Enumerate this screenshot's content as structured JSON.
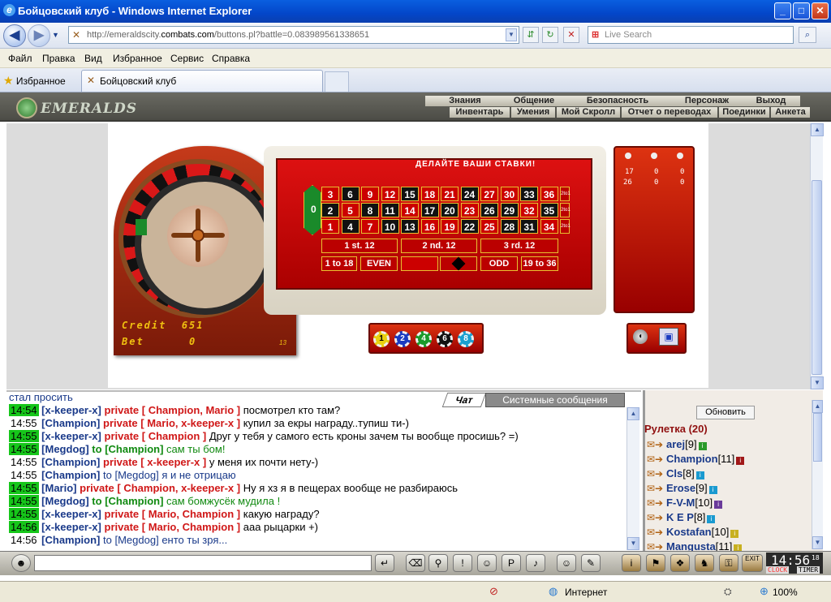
{
  "window": {
    "title": "Бойцовский клуб - Windows Internet Explorer",
    "min": "_",
    "max": "□",
    "close": "✕"
  },
  "nav": {
    "url_prefix": "http://emeraldscity.",
    "url_domain": "combats.com",
    "url_suffix": "/buttons.pl?battle=0.083989561338651",
    "search_placeholder": "Live Search"
  },
  "menu": [
    "Файл",
    "Правка",
    "Вид",
    "Избранное",
    "Сервис",
    "Справка"
  ],
  "favorites_label": "Избранное",
  "tab_title": "Бойцовский клуб",
  "game_header": {
    "logo": "EMERALDS",
    "top_links": [
      "Знания",
      "Общение",
      "Безопасность",
      "Персонаж",
      "Выход"
    ],
    "bottom_links": [
      "Инвентарь",
      "Умения",
      "Мой Скролл",
      "Отчет о переводах",
      "Поединки",
      "Анкета"
    ]
  },
  "roulette": {
    "bet_title": "ДЕЛАЙТЕ ВАШИ СТАВКИ!",
    "credit_label": "Credit",
    "credit_value": "651",
    "bet_label": "Bet",
    "bet_value": "0",
    "small_num": "13",
    "row1": [
      "3",
      "6",
      "9",
      "12",
      "15",
      "18",
      "21",
      "24",
      "27",
      "30",
      "33",
      "36"
    ],
    "row2": [
      "2",
      "5",
      "8",
      "11",
      "14",
      "17",
      "20",
      "23",
      "26",
      "29",
      "32",
      "35"
    ],
    "row3": [
      "1",
      "4",
      "7",
      "10",
      "13",
      "16",
      "19",
      "22",
      "25",
      "28",
      "31",
      "34"
    ],
    "col_label": "2to1",
    "zero": "0",
    "dozens": [
      "1 st. 12",
      "2 nd. 12",
      "3 rd. 12"
    ],
    "outside": [
      "1 to 18",
      "EVEN",
      "ODD",
      "19 to 36"
    ],
    "chips": [
      "1",
      "2",
      "4",
      "6",
      "8"
    ],
    "side_row1": [
      "17",
      "0",
      "0"
    ],
    "side_row2": [
      "26",
      "0",
      "0"
    ]
  },
  "chat": {
    "first_line": "стал просить",
    "tab_chat": "Чат",
    "tab_system": "Системные сообщения",
    "lines": [
      {
        "time": "14:54",
        "green": true,
        "nick": "[x-keeper-x]",
        "kind": "private",
        "target": "[ Champion, Mario ]",
        "text": "посмотрел кто там?"
      },
      {
        "time": "14:55",
        "green": false,
        "nick": "[Champion]",
        "kind": "private",
        "target": "[ Mario, x-keeper-x ]",
        "text": "купил за екры награду..тупиш ти-)"
      },
      {
        "time": "14:55",
        "green": true,
        "nick": "[x-keeper-x]",
        "kind": "private",
        "target": "[ Champion ]",
        "text": "Друг у тебя у самого есть кроны зачем ты вообще просишь? =)"
      },
      {
        "time": "14:55",
        "green": true,
        "nick": "[Megdog]",
        "kind": "to",
        "target": "[Champion]",
        "text": "сам ты бом!"
      },
      {
        "time": "14:55",
        "green": false,
        "nick": "[Champion]",
        "kind": "private",
        "target": "[ x-keeper-x ]",
        "text": "у меня их почти нету-)"
      },
      {
        "time": "14:55",
        "green": false,
        "nick": "[Champion]",
        "kind": "to2",
        "target": "[Megdog]",
        "text": "я и не отрицаю"
      },
      {
        "time": "14:55",
        "green": true,
        "nick": "[Mario]",
        "kind": "private",
        "target": "[ Champion, x-keeper-x ]",
        "text": "Ну я хз я в пещерах вообще не разбираюсь"
      },
      {
        "time": "14:55",
        "green": true,
        "nick": "[Megdog]",
        "kind": "to",
        "target": "[Champion]",
        "text": "сам бомжусёк мудила !"
      },
      {
        "time": "14:55",
        "green": true,
        "nick": "[x-keeper-x]",
        "kind": "private",
        "target": "[ Mario, Champion ]",
        "text": "какую награду?"
      },
      {
        "time": "14:56",
        "green": true,
        "nick": "[x-keeper-x]",
        "kind": "private",
        "target": "[ Mario, Champion ]",
        "text": "ааа рыцарки +)"
      },
      {
        "time": "14:56",
        "green": false,
        "nick": "[Champion]",
        "kind": "to2",
        "target": "[Megdog]",
        "text": "енто ты зря..."
      }
    ],
    "private_word": "private",
    "to_word": "to"
  },
  "users": {
    "refresh": "Обновить",
    "room": "Рулетка (20)",
    "list": [
      {
        "name": "arej",
        "lvl": "[9]",
        "badge": "G"
      },
      {
        "name": "Champion",
        "lvl": "[11]",
        "badge": "R"
      },
      {
        "name": "Cls",
        "lvl": "[8]",
        "badge": "B"
      },
      {
        "name": "Erose",
        "lvl": "[9]",
        "badge": "B"
      },
      {
        "name": "F-V-M",
        "lvl": "[10]",
        "badge": "P"
      },
      {
        "name": "K E P",
        "lvl": "[8]",
        "badge": "B"
      },
      {
        "name": "Kostafan",
        "lvl": "[10]",
        "badge": "Y"
      },
      {
        "name": "Mangusta",
        "lvl": "[11]",
        "badge": "Y"
      }
    ]
  },
  "clock": {
    "time": "14:56",
    "sec": "18",
    "clock_label": "CLOCK",
    "timer_label": "TIMER",
    "exit": "EXIT"
  },
  "status": {
    "zone": "Интернет",
    "zoom": "100%"
  }
}
